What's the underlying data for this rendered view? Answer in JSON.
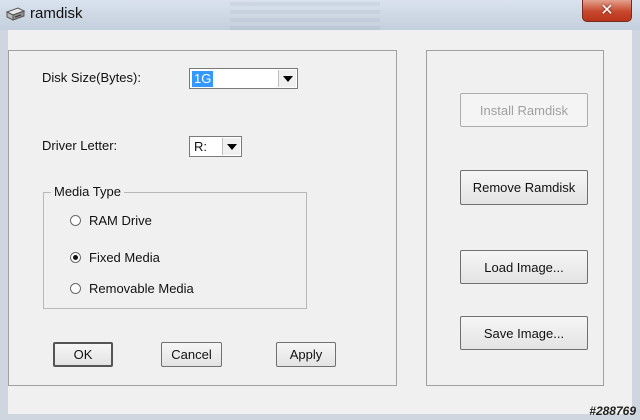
{
  "window": {
    "title": "ramdisk",
    "close_symbol": "✕"
  },
  "form": {
    "disk_size_label": "Disk Size(Bytes):",
    "disk_size_value": "1G",
    "driver_letter_label": "Driver Letter:",
    "driver_letter_value": "R:",
    "media_type_label": "Media Type",
    "media_options": [
      {
        "label": "RAM Drive",
        "checked": false
      },
      {
        "label": "Fixed Media",
        "checked": true
      },
      {
        "label": "Removable Media",
        "checked": false
      }
    ]
  },
  "buttons": {
    "ok": "OK",
    "cancel": "Cancel",
    "apply": "Apply",
    "install": "Install Ramdisk",
    "remove": "Remove Ramdisk",
    "load": "Load Image...",
    "save": "Save Image..."
  },
  "watermark": "#288769",
  "icons": {
    "app": "drive-icon",
    "close": "close-icon",
    "dropdown": "chevron-down-icon"
  }
}
